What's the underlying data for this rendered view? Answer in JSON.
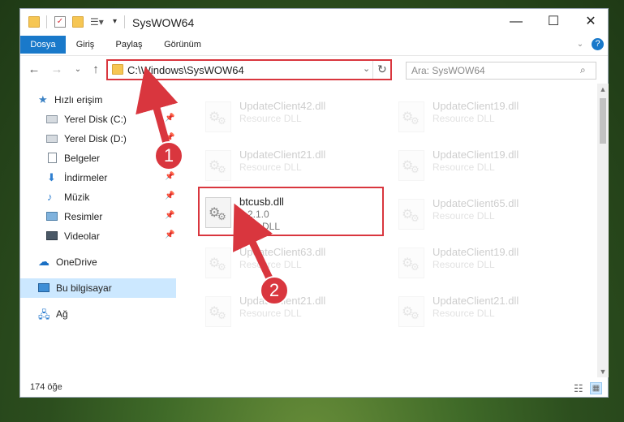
{
  "window": {
    "title": "SysWOW64"
  },
  "ribbon": {
    "tabs": [
      "Dosya",
      "Giriş",
      "Paylaş",
      "Görünüm"
    ]
  },
  "address": {
    "path": "C:\\Windows\\SysWOW64",
    "search_placeholder": "Ara: SysWOW64"
  },
  "sidebar": {
    "items": [
      {
        "label": "Hızlı erişim",
        "icon": "star-icon"
      },
      {
        "label": "Yerel Disk (C:)",
        "icon": "drive-icon"
      },
      {
        "label": "Yerel Disk (D:)",
        "icon": "drive-icon"
      },
      {
        "label": "Belgeler",
        "icon": "document-icon"
      },
      {
        "label": "İndirmeler",
        "icon": "download-icon"
      },
      {
        "label": "Müzik",
        "icon": "music-icon"
      },
      {
        "label": "Resimler",
        "icon": "pictures-icon"
      },
      {
        "label": "Videolar",
        "icon": "video-icon"
      },
      {
        "label": "OneDrive",
        "icon": "cloud-icon"
      },
      {
        "label": "Bu bilgisayar",
        "icon": "computer-icon"
      },
      {
        "label": "Ağ",
        "icon": "network-icon"
      }
    ]
  },
  "files": {
    "highlighted": {
      "name": "btcusb.dll",
      "version": "1.2.1.0",
      "description": "USB DLL"
    },
    "faded": [
      {
        "name": "UpdateClient42.dll",
        "type": "Resource DLL"
      },
      {
        "name": "UpdateClient19.dll",
        "type": "Resource DLL"
      },
      {
        "name": "UpdateClient21.dll",
        "type": "Resource DLL"
      },
      {
        "name": "UpdateClient19.dll",
        "type": "Resource DLL"
      },
      {
        "name": "UpdateClient65.dll",
        "type": "Resource DLL"
      },
      {
        "name": "UpdateClient63.dll",
        "type": "Resource DLL"
      },
      {
        "name": "UpdateClient19.dll",
        "type": "Resource DLL"
      },
      {
        "name": "UpdateClient21.dll",
        "type": "Resource DLL"
      },
      {
        "name": "UpdateClient21.dll",
        "type": "Resource DLL"
      }
    ]
  },
  "status": {
    "item_count": "174 öğe"
  },
  "annotations": {
    "marker1": "1",
    "marker2": "2"
  },
  "colors": {
    "accent": "#1979ca",
    "annotation": "#d9363e",
    "selected": "#cce8ff"
  }
}
